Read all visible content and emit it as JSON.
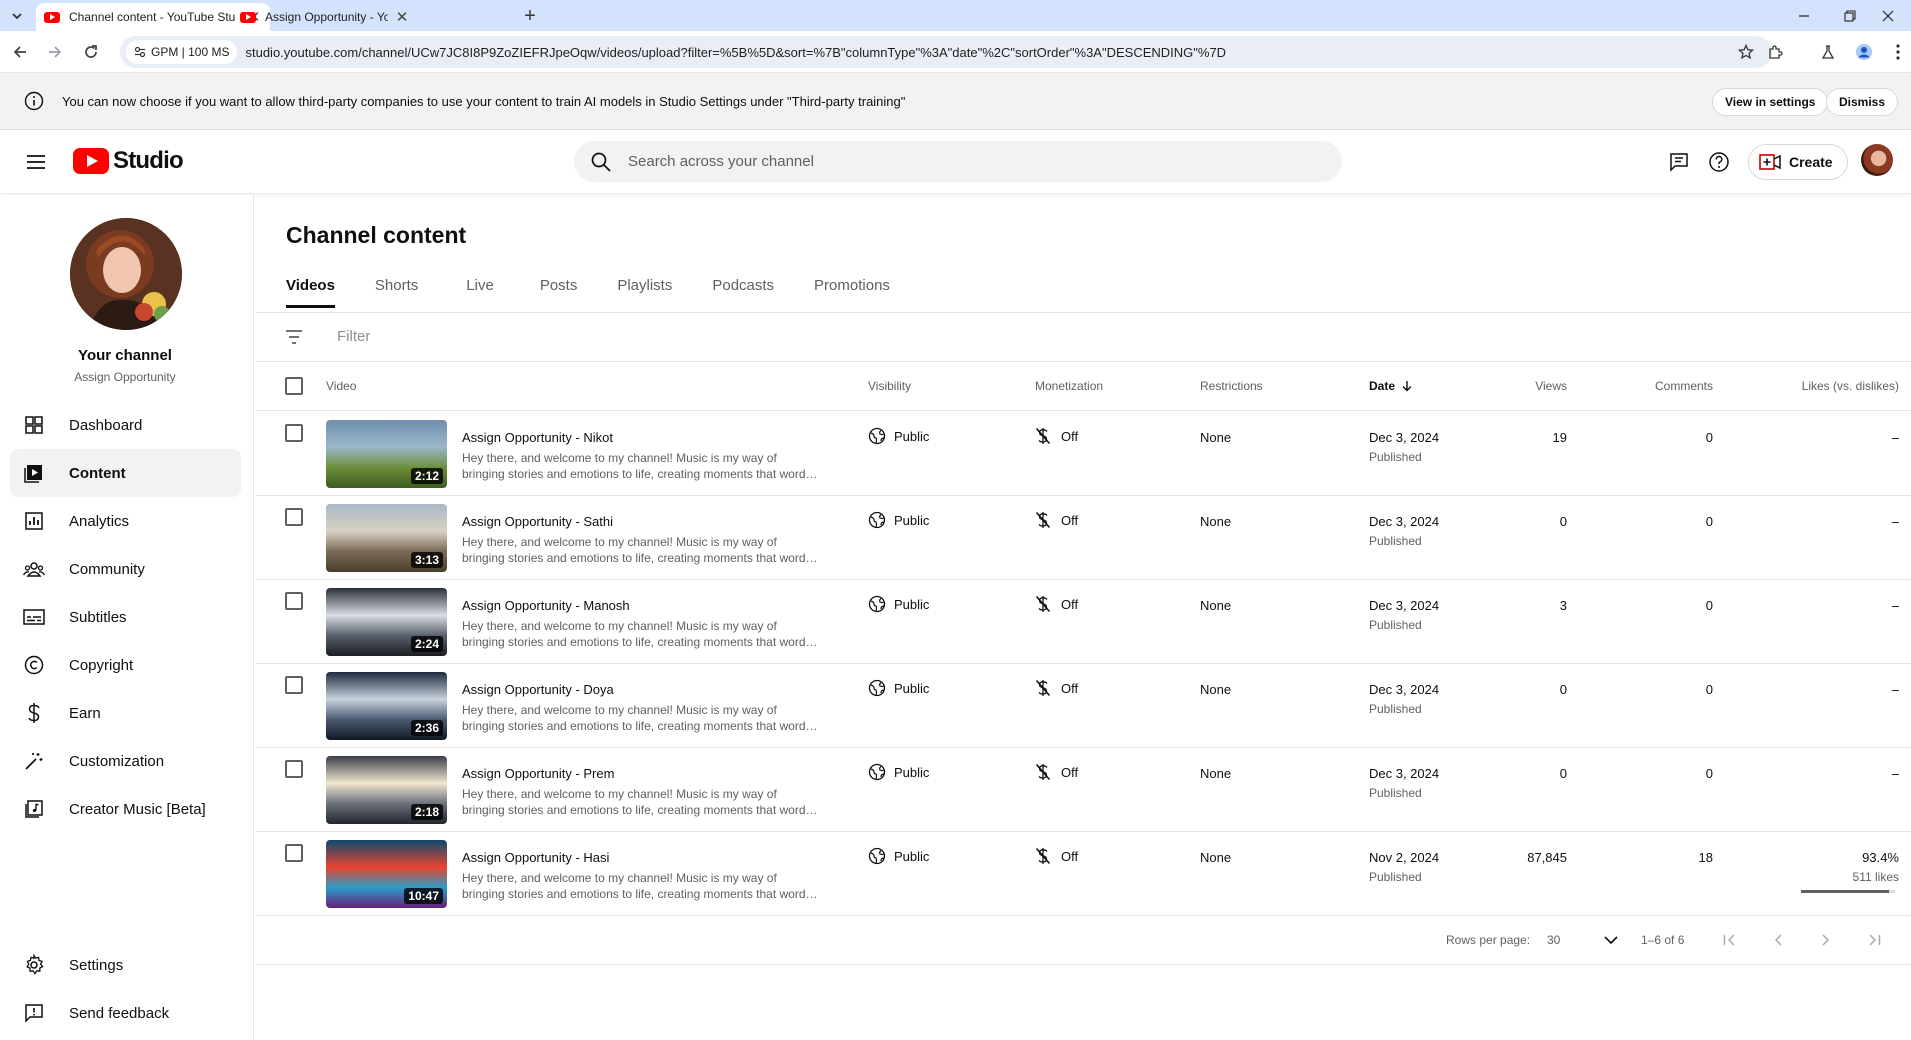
{
  "browser": {
    "tabs": [
      {
        "title": "Channel content - YouTube Stu",
        "active": true
      },
      {
        "title": "Assign Opportunity - YouTube",
        "active": false
      }
    ],
    "site_chip": "GPM | 100 MS",
    "url": "studio.youtube.com/channel/UCw7JC8I8P9ZoZIEFRJpeOqw/videos/upload?filter=%5B%5D&sort=%7B\"columnType\"%3A\"date\"%2C\"sortOrder\"%3A\"DESCENDING\"%7D"
  },
  "banner": {
    "text": "You can now choose if you want to allow third-party companies to use your content to train AI models in Studio Settings under \"Third-party training\"",
    "view_label": "View in settings",
    "dismiss_label": "Dismiss"
  },
  "header": {
    "logo_text": "Studio",
    "search_placeholder": "Search across your channel",
    "create_label": "Create"
  },
  "sidebar": {
    "channel_title": "Your channel",
    "channel_name": "Assign Opportunity",
    "items": [
      {
        "label": "Dashboard",
        "icon": "dashboard-icon"
      },
      {
        "label": "Content",
        "icon": "content-icon",
        "active": true
      },
      {
        "label": "Analytics",
        "icon": "analytics-icon"
      },
      {
        "label": "Community",
        "icon": "community-icon"
      },
      {
        "label": "Subtitles",
        "icon": "subtitles-icon"
      },
      {
        "label": "Copyright",
        "icon": "copyright-icon"
      },
      {
        "label": "Earn",
        "icon": "earn-icon"
      },
      {
        "label": "Customization",
        "icon": "customization-icon"
      },
      {
        "label": "Creator Music [Beta]",
        "icon": "creator-music-icon"
      }
    ],
    "bottom_items": [
      {
        "label": "Settings",
        "icon": "settings-icon"
      },
      {
        "label": "Send feedback",
        "icon": "feedback-icon"
      }
    ]
  },
  "main": {
    "title": "Channel content",
    "tabs": [
      "Videos",
      "Shorts",
      "Live",
      "Posts",
      "Playlists",
      "Podcasts",
      "Promotions"
    ],
    "active_tab": "Videos",
    "filter_placeholder": "Filter",
    "columns": {
      "video": "Video",
      "visibility": "Visibility",
      "monetization": "Monetization",
      "restrictions": "Restrictions",
      "date": "Date",
      "views": "Views",
      "comments": "Comments",
      "likes": "Likes (vs. dislikes)"
    },
    "videos": [
      {
        "title": "Assign Opportunity - Nikot",
        "duration": "2:12",
        "desc1": "Hey there, and welcome to my channel! Music is my way of",
        "desc2": "bringing stories and emotions to life, creating moments that word…",
        "visibility": "Public",
        "monetization": "Off",
        "restrictions": "None",
        "date": "Dec 3, 2024",
        "status": "Published",
        "views": "19",
        "comments": "0",
        "likes": "–",
        "likes_sub": "",
        "likes_ratio": null,
        "thumb_colors": [
          "#6f8fae",
          "#9bb7c9",
          "#6d8f3a",
          "#3d5a20"
        ]
      },
      {
        "title": "Assign Opportunity - Sathi",
        "duration": "3:13",
        "desc1": "Hey there, and welcome to my channel! Music is my way of",
        "desc2": "bringing stories and emotions to life, creating moments that word…",
        "visibility": "Public",
        "monetization": "Off",
        "restrictions": "None",
        "date": "Dec 3, 2024",
        "status": "Published",
        "views": "0",
        "comments": "0",
        "likes": "–",
        "likes_sub": "",
        "likes_ratio": null,
        "thumb_colors": [
          "#a9b8c4",
          "#d8d2c4",
          "#7a6a55",
          "#4a3d2e"
        ]
      },
      {
        "title": "Assign Opportunity - Manosh",
        "duration": "2:24",
        "desc1": "Hey there, and welcome to my channel! Music is my way of",
        "desc2": "bringing stories and emotions to life, creating moments that word…",
        "visibility": "Public",
        "monetization": "Off",
        "restrictions": "None",
        "date": "Dec 3, 2024",
        "status": "Published",
        "views": "3",
        "comments": "0",
        "likes": "–",
        "likes_sub": "",
        "likes_ratio": null,
        "thumb_colors": [
          "#2b2f38",
          "#d9dde3",
          "#5a616d",
          "#1a1c21"
        ]
      },
      {
        "title": "Assign Opportunity - Doya",
        "duration": "2:36",
        "desc1": "Hey there, and welcome to my channel! Music is my way of",
        "desc2": "bringing stories and emotions to life, creating moments that word…",
        "visibility": "Public",
        "monetization": "Off",
        "restrictions": "None",
        "date": "Dec 3, 2024",
        "status": "Published",
        "views": "0",
        "comments": "0",
        "likes": "–",
        "likes_sub": "",
        "likes_ratio": null,
        "thumb_colors": [
          "#1e2a3c",
          "#c9d2de",
          "#4b5b72",
          "#101723"
        ]
      },
      {
        "title": "Assign Opportunity - Prem",
        "duration": "2:18",
        "desc1": "Hey there, and welcome to my channel! Music is my way of",
        "desc2": "bringing stories and emotions to life, creating moments that word…",
        "visibility": "Public",
        "monetization": "Off",
        "restrictions": "None",
        "date": "Dec 3, 2024",
        "status": "Published",
        "views": "0",
        "comments": "0",
        "likes": "–",
        "likes_sub": "",
        "likes_ratio": null,
        "thumb_colors": [
          "#3a3f4a",
          "#f0e6cf",
          "#6b717c",
          "#22252c"
        ]
      },
      {
        "title": "Assign Opportunity - Hasi",
        "duration": "10:47",
        "desc1": "Hey there, and welcome to my channel! Music is my way of",
        "desc2": "bringing stories and emotions to life, creating moments that word…",
        "visibility": "Public",
        "monetization": "Off",
        "restrictions": "None",
        "date": "Nov 2, 2024",
        "status": "Published",
        "views": "87,845",
        "comments": "18",
        "likes": "93.4%",
        "likes_sub": "511 likes",
        "likes_ratio": 0.934,
        "thumb_colors": [
          "#0e4a6e",
          "#e8442e",
          "#2a9cc8",
          "#6a1f7a"
        ]
      }
    ],
    "pagination": {
      "rows_label": "Rows per page:",
      "rows_value": "30",
      "range": "1–6 of 6"
    }
  }
}
